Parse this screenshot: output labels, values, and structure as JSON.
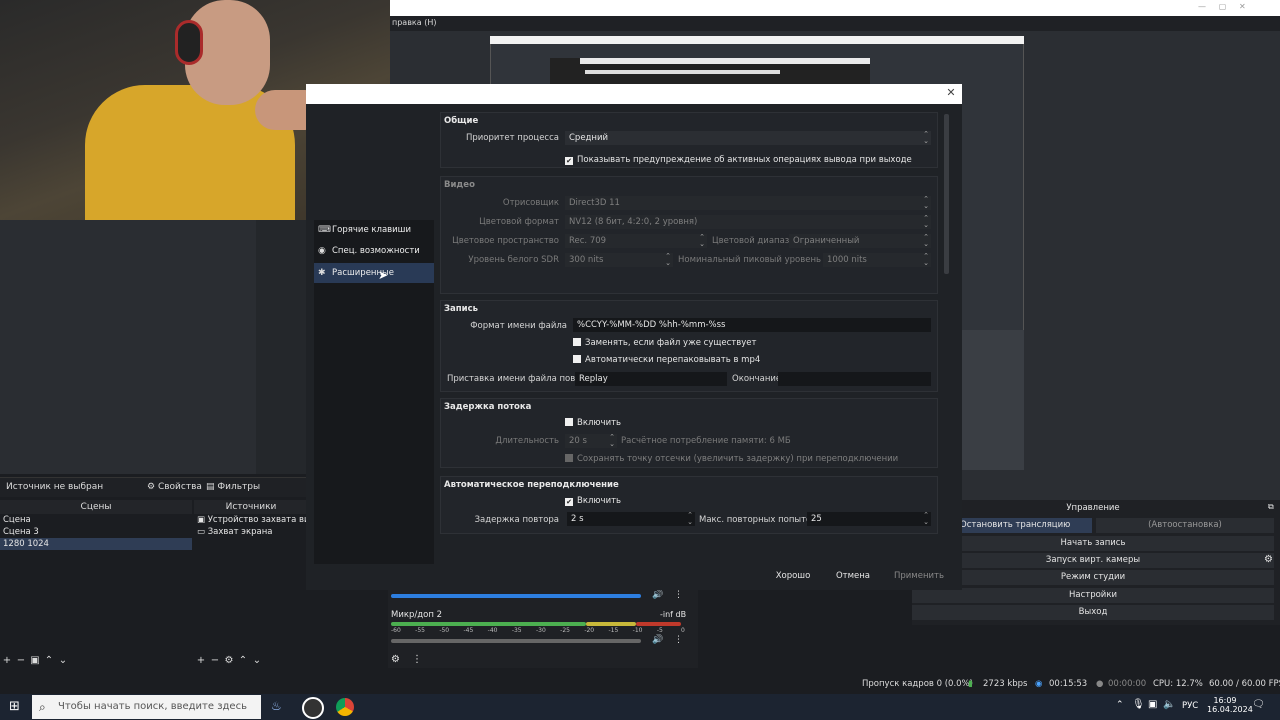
{
  "menubar": {
    "item": "правка (H)"
  },
  "source_bar": {
    "no_source": "Источник не выбран",
    "properties": "Свойства",
    "filters": "Фильтры"
  },
  "scenes": {
    "header": "Сцены",
    "items": [
      "Сцена",
      "Сцена 3",
      "1280 1024"
    ]
  },
  "sources": {
    "header": "Источники",
    "items": [
      "Устройство захвата видео",
      "Захват экрана"
    ]
  },
  "dialog": {
    "nav": [
      "Горячие клавиши",
      "Спец. возможности",
      "Расширенные"
    ],
    "general": {
      "title": "Общие",
      "priority_label": "Приоритет процесса",
      "priority_value": "Средний",
      "warn_checkbox": "Показывать предупреждение об активных операциях вывода при выходе"
    },
    "video": {
      "title": "Видео",
      "renderer_label": "Отрисовщик",
      "renderer_value": "Direct3D 11",
      "color_format_label": "Цветовой формат",
      "color_format_value": "NV12 (8 бит, 4:2:0, 2 уровня)",
      "color_space_label": "Цветовое пространство",
      "color_space_value": "Rec. 709",
      "color_range_label": "Цветовой диапазон",
      "color_range_value": "Ограниченный",
      "sdr_label": "Уровень белого SDR",
      "sdr_value": "300 nits",
      "hdr_label": "Номинальный пиковый уровень HDR",
      "hdr_value": "1000 nits"
    },
    "recording": {
      "title": "Запись",
      "filename_label": "Формат имени файла",
      "filename_value": "%CCYY-%MM-%DD %hh-%mm-%ss",
      "overwrite": "Заменять, если файл уже существует",
      "remux": "Автоматически перепаковывать в mp4",
      "replay_prefix_label": "Приставка имени файла повтора",
      "replay_prefix_value": "Replay",
      "suffix_label": "Окончание",
      "suffix_value": ""
    },
    "stream_delay": {
      "title": "Задержка потока",
      "enable": "Включить",
      "duration_label": "Длительность",
      "duration_value": "20 s",
      "memory": "Расчётное потребление памяти: 6 МБ",
      "preserve": "Сохранять точку отсечки (увеличить задержку) при переподключении"
    },
    "reconnect": {
      "title": "Автоматическое переподключение",
      "enable": "Включить",
      "retry_label": "Задержка повтора",
      "retry_value": "2 s",
      "max_label": "Макс. повторных попыток",
      "max_value": "25"
    },
    "buttons": {
      "ok": "Хорошо",
      "cancel": "Отмена",
      "apply": "Применить"
    }
  },
  "mixer": {
    "track": "Микр/доп 2",
    "level": "-inf dB",
    "scale": [
      "-60",
      "-55",
      "-50",
      "-45",
      "-40",
      "-35",
      "-30",
      "-25",
      "-20",
      "-15",
      "-10",
      "-5",
      "0"
    ]
  },
  "controls": {
    "header": "Управление",
    "stop_stream": "Остановить трансляцию",
    "auto_stop": "(Автоостановка)",
    "start_recording": "Начать запись",
    "virtual_camera": "Запуск вирт. камеры",
    "studio_mode": "Режим студии",
    "settings": "Настройки",
    "exit": "Выход"
  },
  "status": {
    "dropped_frames": "Пропуск кадров 0 (0.0%)",
    "bitrate": "2723 kbps",
    "stream_time": "00:15:53",
    "record_time": "00:00:00",
    "cpu": "CPU: 12.7%",
    "fps": "60.00 / 60.00 FPS"
  },
  "taskbar": {
    "search_placeholder": "Чтобы начать поиск, введите здесь запрос",
    "lang": "РУС",
    "time": "16:09",
    "date": "16.04.2024"
  },
  "colors": {
    "accent": "#293a56",
    "meter_green": "#4caf50",
    "meter_yellow": "#c8b83a",
    "meter_red": "#c0392b"
  }
}
